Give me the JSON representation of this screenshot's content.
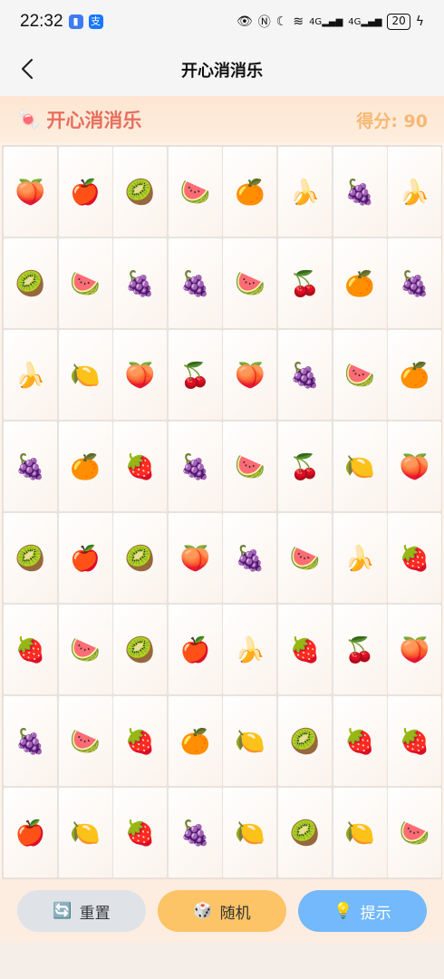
{
  "status": {
    "time": "22:32",
    "battery": "20",
    "signal_labels": [
      "4G",
      "4G"
    ]
  },
  "nav": {
    "title": "开心消消乐",
    "back_icon": "chevron-left-icon"
  },
  "game": {
    "title": "开心消消乐",
    "title_icon": "candy-icon",
    "score_label": "得分: 90"
  },
  "board": {
    "rows": [
      [
        "peach",
        "apple",
        "kiwi",
        "watermelon",
        "orange",
        "banana",
        "grapes",
        "banana"
      ],
      [
        "kiwi",
        "watermelon",
        "grapes",
        "grapes",
        "watermelon",
        "cherries",
        "orange",
        "grapes"
      ],
      [
        "banana",
        "lemon",
        "peach",
        "cherries",
        "peach",
        "grapes",
        "watermelon",
        "orange"
      ],
      [
        "grapes",
        "orange",
        "strawberry",
        "grapes",
        "watermelon",
        "cherries",
        "lemon",
        "peach"
      ],
      [
        "kiwi",
        "apple",
        "kiwi",
        "peach",
        "grapes",
        "watermelon",
        "banana",
        "strawberry"
      ],
      [
        "strawberry",
        "watermelon",
        "kiwi",
        "apple",
        "banana",
        "strawberry",
        "cherries",
        "peach"
      ],
      [
        "grapes",
        "watermelon",
        "strawberry",
        "orange",
        "lemon",
        "kiwi",
        "strawberry",
        "strawberry"
      ],
      [
        "apple",
        "lemon",
        "strawberry",
        "grapes",
        "lemon",
        "kiwi",
        "lemon",
        "watermelon"
      ]
    ],
    "glyphs": {
      "peach": "🍑",
      "apple": "🍎",
      "kiwi": "🥝",
      "watermelon": "🍉",
      "orange": "🍊",
      "banana": "🍌",
      "grapes": "🍇",
      "cherries": "🍒",
      "lemon": "🍋",
      "strawberry": "🍓"
    }
  },
  "toolbar": {
    "reset_label": "重置",
    "random_label": "随机",
    "hint_label": "提示"
  },
  "colors": {
    "title": "#e96e5e",
    "score": "#f6b874",
    "reset_btn": "#dfe3e8",
    "random_btn": "#fcc466",
    "hint_btn": "#73b9fb"
  }
}
